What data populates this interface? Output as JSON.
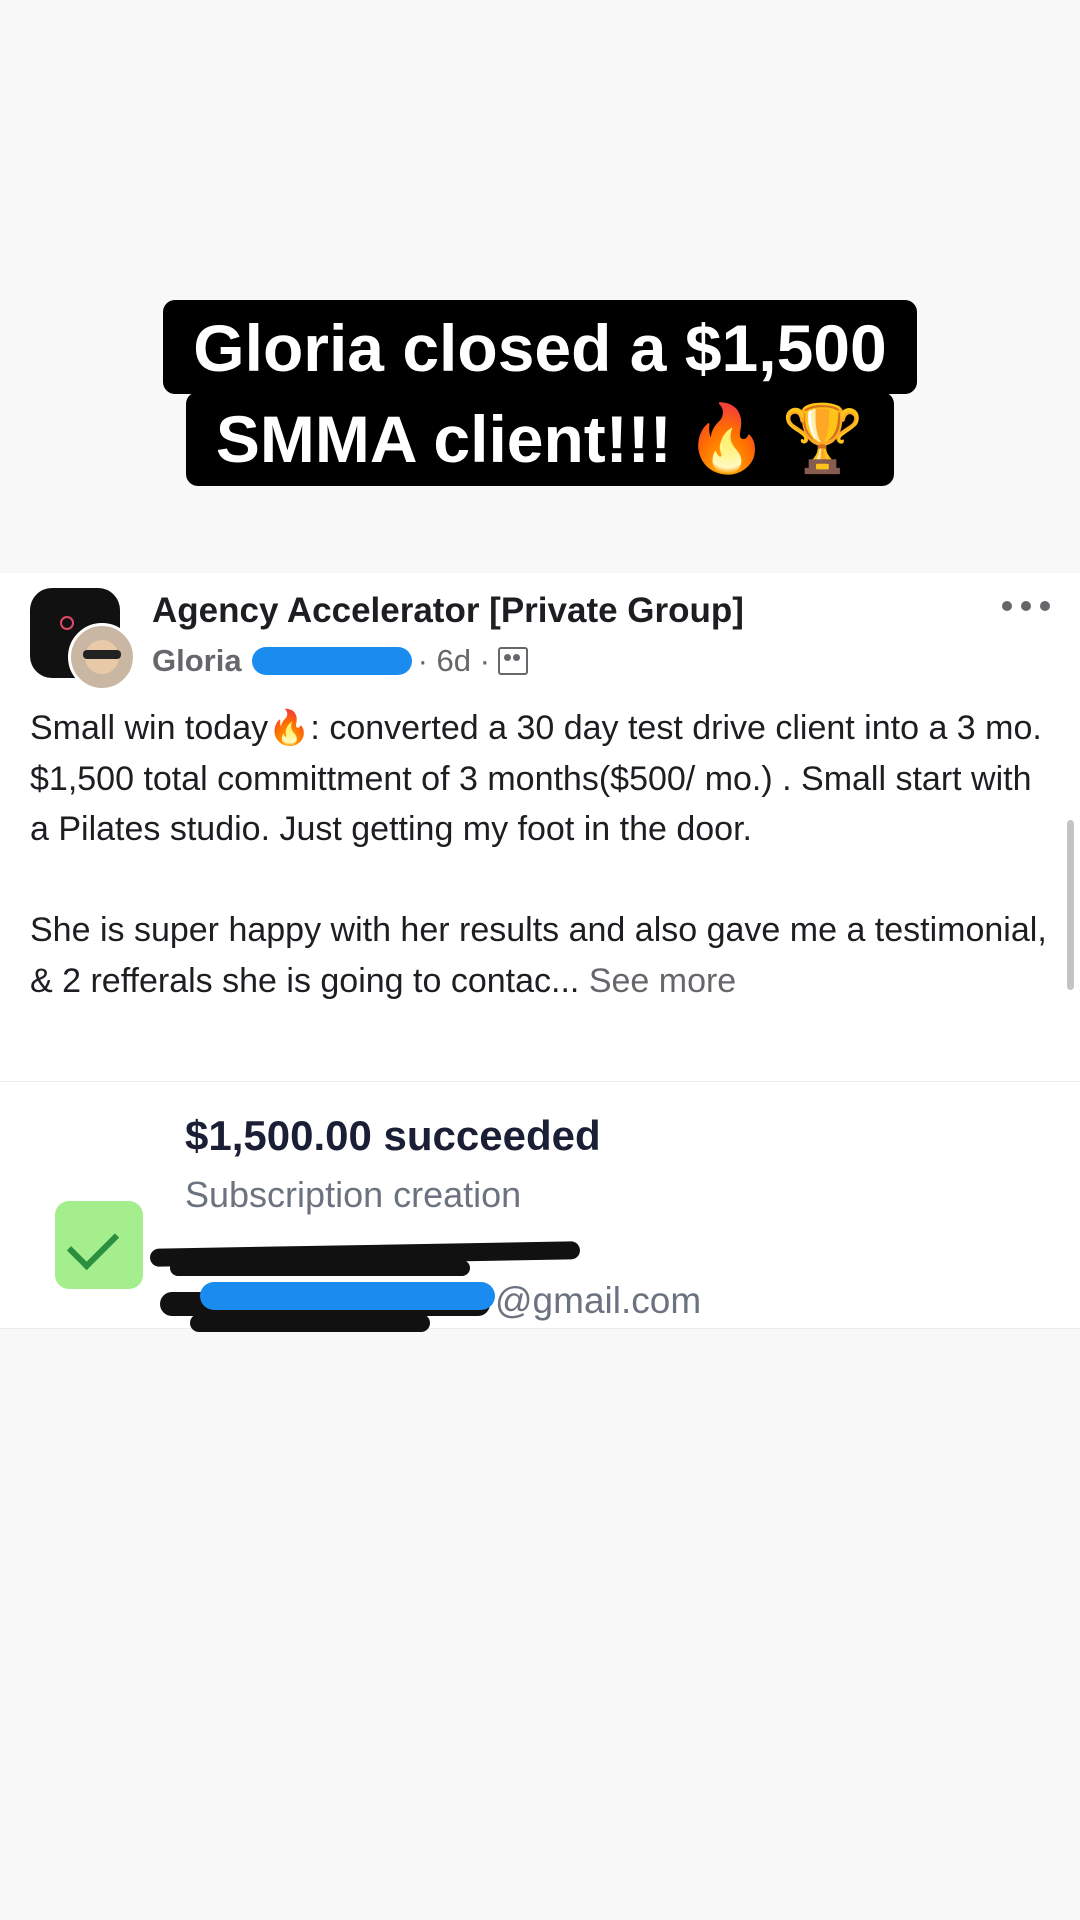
{
  "headline": {
    "line1": "Gloria closed a $1,500",
    "line2": "SMMA client!!!",
    "emoji_fire": "🔥",
    "emoji_trophy": "🏆"
  },
  "post": {
    "group_name": "Agency Accelerator [Private Group]",
    "author": "Gloria",
    "time": "· 6d ·",
    "paragraph1": "Small win today🔥: converted a 30 day test drive client into a 3 mo. $1,500 total committment of 3 months($500/ mo.) . Small start with a Pilates studio. Just getting my foot in the door.",
    "paragraph2": "She is super happy with her results and also gave me a testimonial, & 2 refferals she is going to contac...",
    "see_more": "See more",
    "icons": {
      "more": "more-options-icon",
      "privacy": "private-group-icon",
      "group": "group-avatar",
      "user": "user-avatar"
    }
  },
  "payment": {
    "amount_status": "$1,500.00 succeeded",
    "type": "Subscription creation",
    "email_suffix": "@gmail.com",
    "icon": "check-icon",
    "colors": {
      "check_bg": "#a4ee8e",
      "check_mark": "#2a8f3e",
      "redaction_blue": "#1a8cf0"
    }
  }
}
